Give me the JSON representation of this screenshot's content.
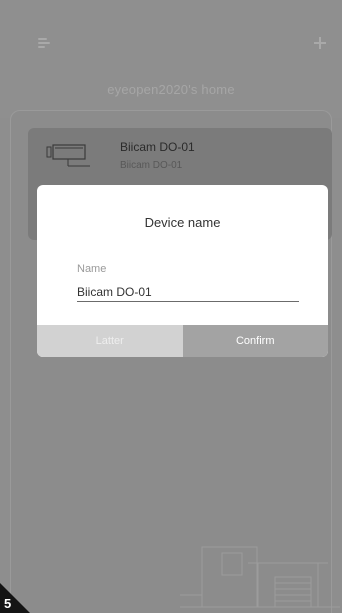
{
  "header": {
    "title": "eyeopen2020's home",
    "menu_icon": "menu-icon",
    "add_icon": "plus-icon"
  },
  "device_card": {
    "name": "Biicam DO-01",
    "model": "Biicam DO-01",
    "icon": "camera-icon"
  },
  "dialog": {
    "title": "Device name",
    "field_label": "Name",
    "field_value": "Biicam DO-01",
    "later_label": "Latter",
    "confirm_label": "Confirm"
  },
  "page_number": "5",
  "colors": {
    "overlay": "#8e8e8e",
    "dialog_bg": "#ffffff",
    "later_bg": "#d2d2d2",
    "confirm_bg": "#a3a3a3"
  }
}
